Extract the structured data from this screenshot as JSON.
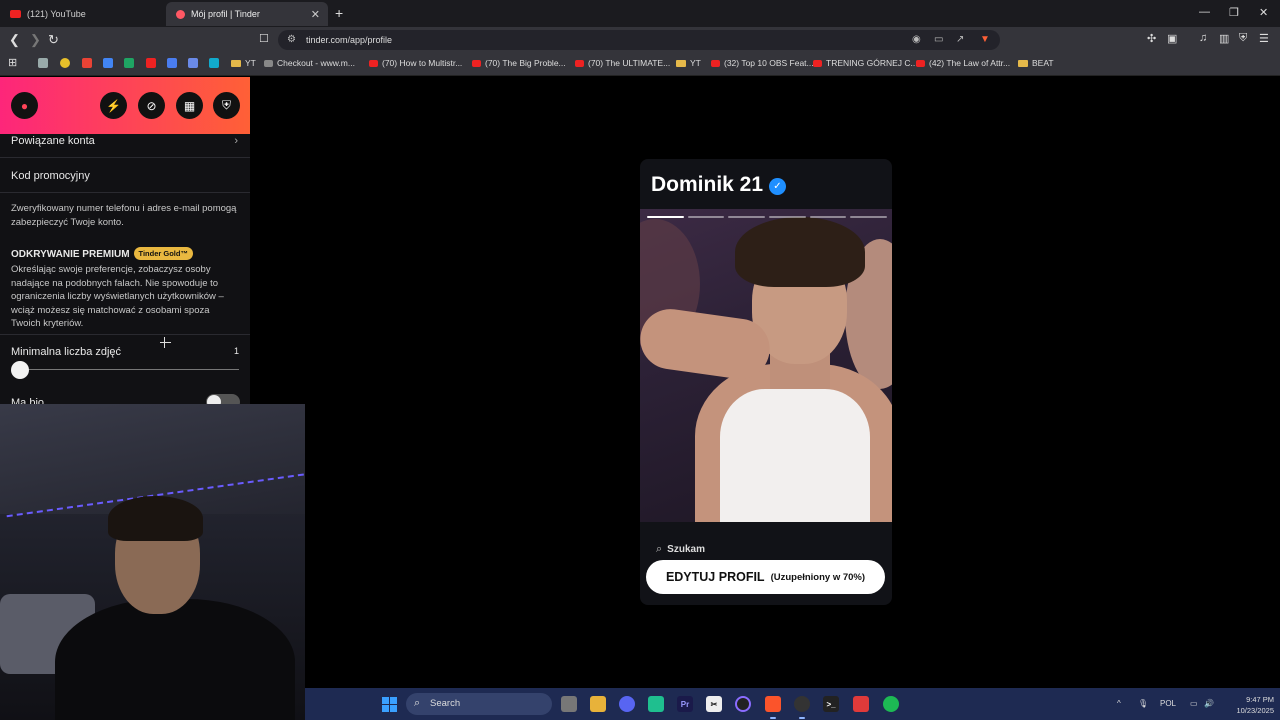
{
  "browser": {
    "tabs": [
      {
        "title": "(121) YouTube",
        "active": false
      },
      {
        "title": "Mój profil | Tinder",
        "active": true
      }
    ],
    "url": "tinder.com/app/profile",
    "bookmarks": [
      "Checkout - www.m...",
      "(70) How to Multistr...",
      "(70) The Big Proble...",
      "(70) The ULTIMATE...",
      "YT",
      "(32) Top 10 OBS Feat...",
      "TRENING GÓRNEJ C...",
      "(42) The Law of Attr...",
      "BEAT"
    ],
    "bookmark_folder_first": "YT"
  },
  "sidebar": {
    "linked_accounts": "Powiązane konta",
    "promo_code": "Kod promocyjny",
    "verify_note": "Zweryfikowany numer telefonu i adres e-mail pomogą zabezpieczyć Twoje konto.",
    "premium_title": "ODKRYWANIE PREMIUM",
    "premium_badge": "Tinder Gold™",
    "premium_desc": "Określając swoje preferencje, zobaczysz osoby nadające na podobnych falach. Nie spowoduje to ograniczenia liczby wyświetlanych użytkowników – wciąż możesz się matchować z osobami spoza Twoich kryteriów.",
    "min_photos_label": "Minimalna liczba zdjęć",
    "min_photos_value": "1",
    "bio_label": "Ma bio",
    "min_photos_fraction": 0.0,
    "bio_toggle_on": false
  },
  "card": {
    "name_age": "Dominik 21",
    "photo_count": 6,
    "active_photo": 1,
    "looking_for": "Szukam",
    "edit_button": "EDYTUJ PROFIL",
    "completion": "(Uzupełniony w 70%)"
  },
  "taskbar": {
    "search_placeholder": "Search",
    "language": "POL",
    "time": "9:47 PM",
    "date": "10/23/2025"
  },
  "colors": {
    "tinder_gradient_start": "#fd267a",
    "tinder_gradient_end": "#ff6036",
    "gold_badge": "#e9b840",
    "verified_blue": "#1f8fff",
    "taskbar": "#1e2a52"
  }
}
